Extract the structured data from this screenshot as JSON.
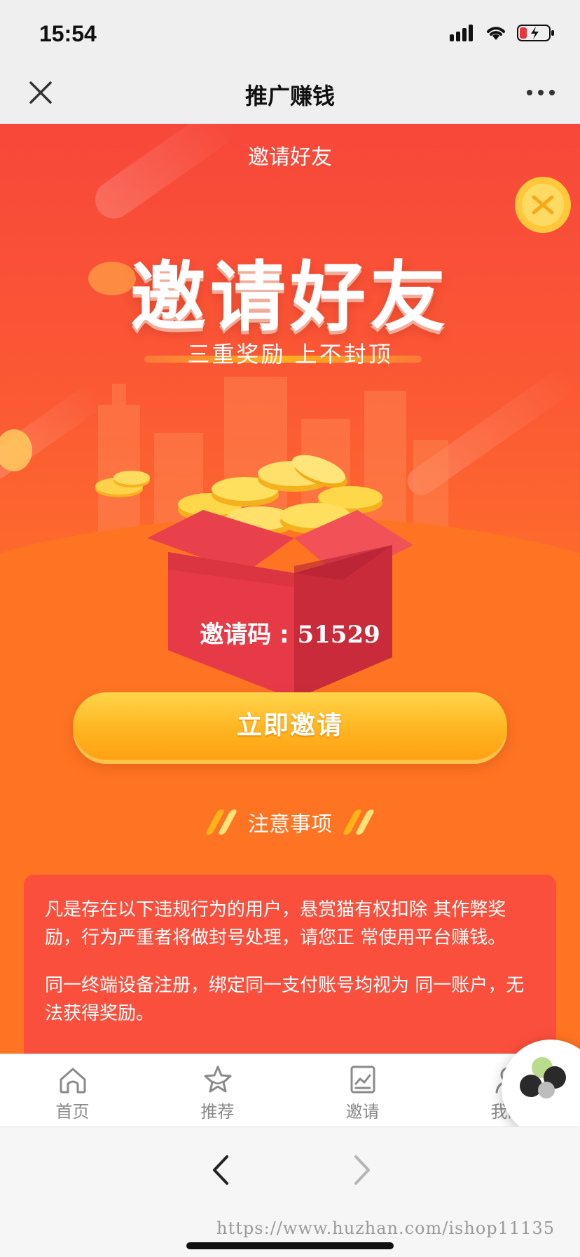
{
  "status_bar": {
    "time": "15:54"
  },
  "nav": {
    "title": "推广赚钱"
  },
  "hero": {
    "subtitle": "邀请好友",
    "title": "邀请好友",
    "tagline": "三重奖励 上不封顶"
  },
  "invite": {
    "code_label": "邀请码 : ",
    "code_value": "51529",
    "button_label": "立即邀请"
  },
  "notice": {
    "title": "注意事项",
    "paragraphs": [
      "凡是存在以下违规行为的用户，悬赏猫有权扣除 其作弊奖励，行为严重者将做封号处理，请您正 常使用平台赚钱。",
      "同一终端设备注册，绑定同一支付账号均视为 同一账户，无法获得奖励。"
    ]
  },
  "tabs": [
    {
      "label": "首页",
      "icon": "home-icon"
    },
    {
      "label": "推荐",
      "icon": "star-icon"
    },
    {
      "label": "邀请",
      "icon": "invite-chart-icon"
    },
    {
      "label": "我的",
      "icon": "profile-icon"
    }
  ],
  "watermark": "https://www.huzhan.com/ishop11135",
  "colors": {
    "banner_red": "#f7473a",
    "banner_orange": "#ff7a24",
    "button_yellow": "#ffb21e",
    "notice_card": "#fb4f3d"
  }
}
